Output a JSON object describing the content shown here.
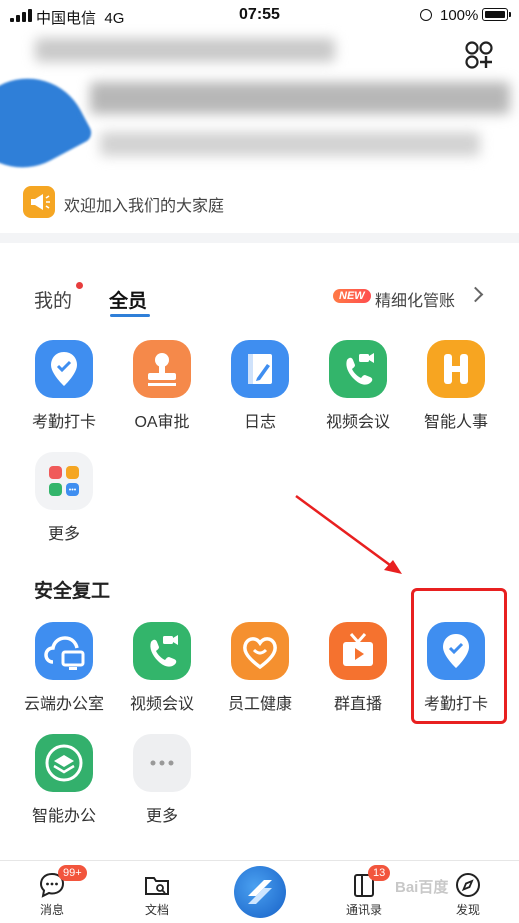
{
  "status_bar": {
    "carrier": "中国电信",
    "network": "4G",
    "time": "07:55",
    "battery": "100%"
  },
  "notice": {
    "text": "欢迎加入我们的大家庭"
  },
  "tabs": {
    "mine": "我的",
    "all": "全员"
  },
  "manage": {
    "badge": "NEW",
    "label": "精细化管账"
  },
  "apps_all": [
    {
      "label": "考勤打卡",
      "icon": "location-pin-icon",
      "color": "#3f8ef0"
    },
    {
      "label": "OA审批",
      "icon": "stamp-icon",
      "color": "#f5894a"
    },
    {
      "label": "日志",
      "icon": "notebook-pen-icon",
      "color": "#3f8ef0"
    },
    {
      "label": "视频会议",
      "icon": "video-phone-icon",
      "color": "#33b56b"
    },
    {
      "label": "智能人事",
      "icon": "h-letter-icon",
      "color": "#f7a521"
    },
    {
      "label": "更多",
      "icon": "more-grid-icon",
      "color": "#f2f3f5"
    }
  ],
  "section_safe": {
    "title": "安全复工"
  },
  "apps_safe": [
    {
      "label": "云端办公室",
      "icon": "cloud-monitor-icon",
      "color": "#3f8ef0"
    },
    {
      "label": "视频会议",
      "icon": "video-phone-icon",
      "color": "#33b56b"
    },
    {
      "label": "员工健康",
      "icon": "heart-smile-icon",
      "color": "#f5902f"
    },
    {
      "label": "群直播",
      "icon": "tv-play-icon",
      "color": "#f5722f"
    },
    {
      "label": "考勤打卡",
      "icon": "location-pin-icon",
      "color": "#3f8ef0"
    },
    {
      "label": "智能办公",
      "icon": "layers-icon",
      "color": "#33b06c"
    },
    {
      "label": "更多",
      "icon": "more-dots-icon",
      "color": "#eeeff1"
    }
  ],
  "bottom_nav": {
    "messages": {
      "label": "消息",
      "badge": "99+"
    },
    "docs": {
      "label": "文档"
    },
    "contacts": {
      "label": "通讯录",
      "badge": "13"
    },
    "discover": {
      "label": "发现"
    }
  },
  "watermark": "Bai百度"
}
